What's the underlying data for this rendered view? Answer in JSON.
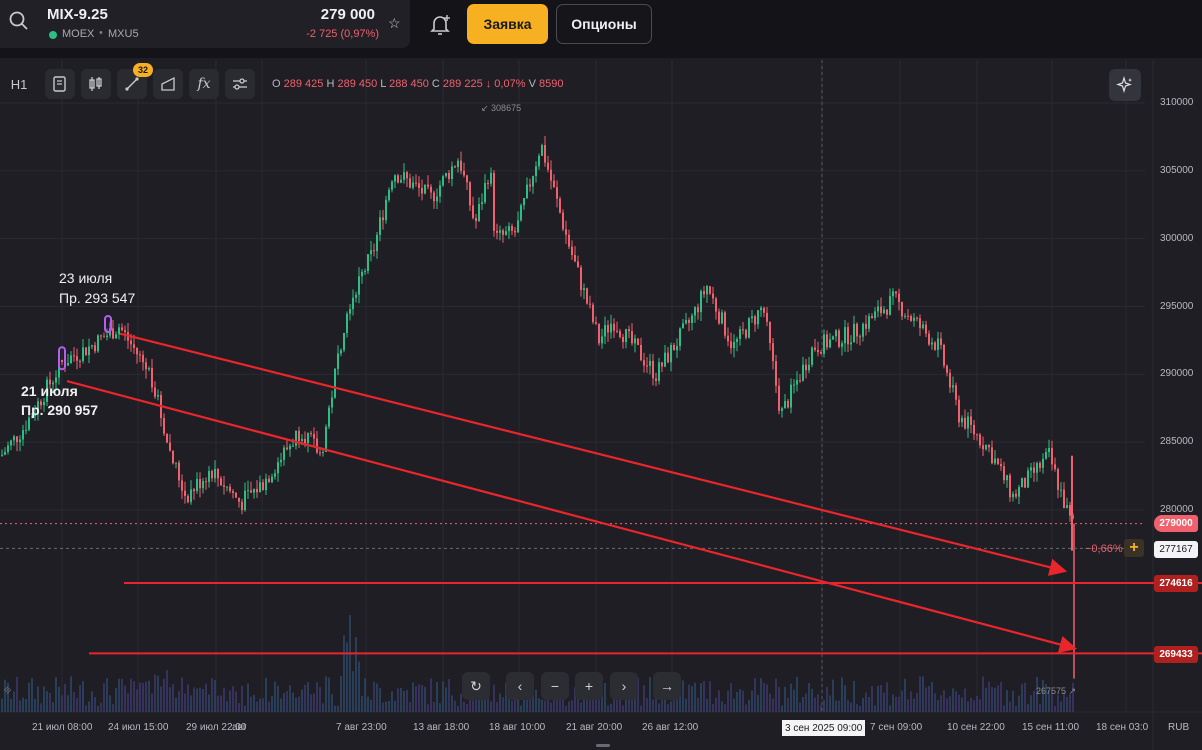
{
  "header": {
    "symbol": "MIX-9.25",
    "exchange": "MOEX",
    "code": "MXU5",
    "price": "279 000",
    "change": "-2 725 (0,97%)",
    "order_button": "Заявка",
    "options_button": "Опционы"
  },
  "toolbar": {
    "interval": "H1",
    "badge_count": "32",
    "ohlc": {
      "o_label": "O",
      "o": "289 425",
      "h_label": "H",
      "h": "289 450",
      "l_label": "L",
      "l": "288 450",
      "c_label": "C",
      "c": "289 225",
      "pct": "↓ 0,07%",
      "v_label": "V",
      "v": "8590"
    }
  },
  "annotations": {
    "july23_date": "23 июля",
    "july23_price": "Пр. 293 547",
    "july21_date": "21 июля",
    "july21_price": "Пр. 290 957",
    "high_marker": "308675",
    "low_marker": "267575",
    "pct_label": "−0,66%"
  },
  "price_tags": {
    "current": "279000",
    "cursor": "277167",
    "level1": "274616",
    "level2": "269433"
  },
  "crosshair_time": "3 сен 2025 09:00",
  "currency": "RUB",
  "colors": {
    "up": "#2ebd85",
    "down": "#f0616d",
    "accent": "#f6b021",
    "drawing": "#e8262b",
    "background": "#1e1e24"
  },
  "chart_data": {
    "type": "candlestick",
    "yaxis_ticks": [
      310000,
      305000,
      300000,
      295000,
      290000,
      285000,
      280000
    ],
    "ylim": [
      267000,
      311500
    ],
    "xaxis_ticks": [
      "21 июл 08:00",
      "24 июл 15:00",
      "29 июл 22:00",
      "авг",
      "7 авг 23:00",
      "13 авг 18:00",
      "18 авг 10:00",
      "21 авг 20:00",
      "26 авг 12:00",
      "3 сен 2025 09:00",
      "7 сен 09:00",
      "10 сен 22:00",
      "15 сен 11:00",
      "18 сен 03:0"
    ],
    "price_path_keypoints": [
      {
        "t": "19 июл",
        "p": 284000
      },
      {
        "t": "20 июл",
        "p": 286000
      },
      {
        "t": "21 июл",
        "p": 290957
      },
      {
        "t": "22 июл",
        "p": 292000
      },
      {
        "t": "23 июл",
        "p": 293547
      },
      {
        "t": "25 июл",
        "p": 290000
      },
      {
        "t": "27 июл",
        "p": 284000
      },
      {
        "t": "28 июл",
        "p": 281000
      },
      {
        "t": "29 июл",
        "p": 283000
      },
      {
        "t": "31 июл",
        "p": 280500
      },
      {
        "t": "2 авг",
        "p": 282000
      },
      {
        "t": "4 авг",
        "p": 286000
      },
      {
        "t": "5 авг",
        "p": 284000
      },
      {
        "t": "6 авг",
        "p": 295000
      },
      {
        "t": "7 авг",
        "p": 299000
      },
      {
        "t": "8 авг",
        "p": 305000
      },
      {
        "t": "10 авг",
        "p": 303000
      },
      {
        "t": "12 авг",
        "p": 306000
      },
      {
        "t": "14 авг",
        "p": 301000
      },
      {
        "t": "15 авг",
        "p": 305000
      },
      {
        "t": "16 авг",
        "p": 308675
      },
      {
        "t": "17 авг",
        "p": 300000
      },
      {
        "t": "19 авг",
        "p": 300500
      },
      {
        "t": "20 авг",
        "p": 307000
      },
      {
        "t": "22 авг",
        "p": 300000
      },
      {
        "t": "24 авг",
        "p": 292500
      },
      {
        "t": "26 авг",
        "p": 294000
      },
      {
        "t": "27 авг",
        "p": 290000
      },
      {
        "t": "29 авг",
        "p": 294000
      },
      {
        "t": "31 авг",
        "p": 296500
      },
      {
        "t": "2 сен",
        "p": 292000
      },
      {
        "t": "4 сен",
        "p": 295000
      },
      {
        "t": "6 сен",
        "p": 287000
      },
      {
        "t": "8 сен",
        "p": 292000
      },
      {
        "t": "10 сен",
        "p": 293000
      },
      {
        "t": "12 сен",
        "p": 295500
      },
      {
        "t": "13 сен",
        "p": 292000
      },
      {
        "t": "14 сен",
        "p": 287000
      },
      {
        "t": "15 сен",
        "p": 284500
      },
      {
        "t": "16 сен",
        "p": 281000
      },
      {
        "t": "16 сен 12:00",
        "p": 284000
      },
      {
        "t": "17 сен",
        "p": 279000
      }
    ],
    "spike_low": 267575,
    "horizontal_levels": [
      274616,
      269433
    ],
    "trend_lines": [
      {
        "from": {
          "t": "23 июл",
          "p": 293000
        },
        "to": {
          "t": "17 сен",
          "p": 275500
        }
      },
      {
        "from": {
          "t": "21 июл",
          "p": 289500
        },
        "to": {
          "t": "17 сен",
          "p": 269800
        }
      }
    ]
  }
}
